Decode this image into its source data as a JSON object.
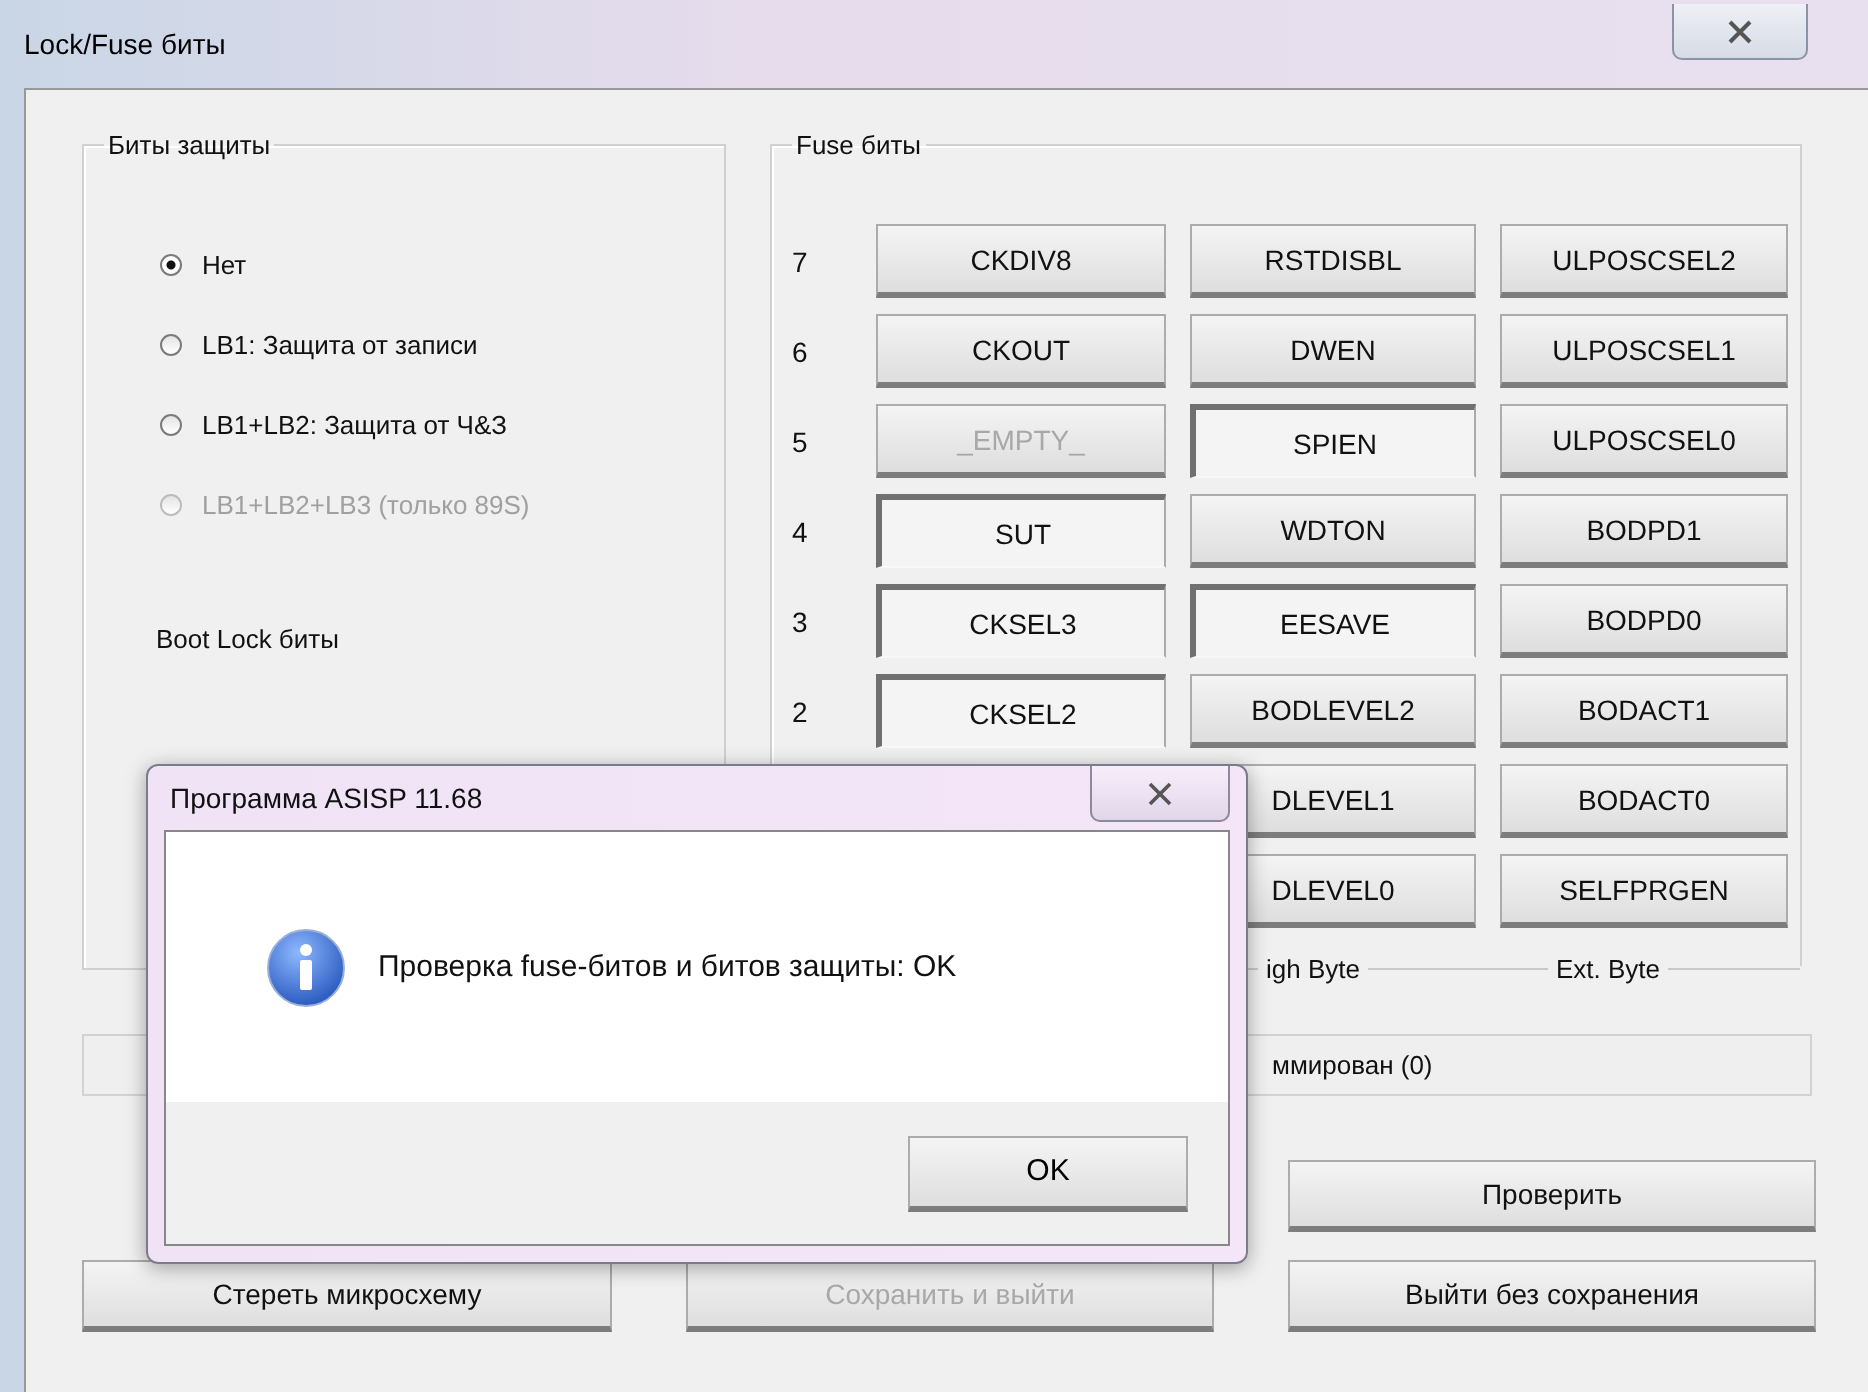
{
  "window": {
    "title": "Lock/Fuse биты"
  },
  "lock_bits": {
    "title": "Биты защиты",
    "options": [
      {
        "label": "Нет",
        "selected": true,
        "disabled": false
      },
      {
        "label": "LB1: Защита от записи",
        "selected": false,
        "disabled": false
      },
      {
        "label": "LB1+LB2: Защита от Ч&З",
        "selected": false,
        "disabled": false
      },
      {
        "label": "LB1+LB2+LB3 (только 89S)",
        "selected": false,
        "disabled": true
      }
    ],
    "boot_lock_label": "Boot Lock биты"
  },
  "fuse_bits": {
    "title": "Fuse биты",
    "rows": [
      {
        "bit": "7",
        "cells": [
          {
            "label": "CKDIV8",
            "pressed": false,
            "disabled": false
          },
          {
            "label": "RSTDISBL",
            "pressed": false,
            "disabled": false
          },
          {
            "label": "ULPOSCSEL2",
            "pressed": false,
            "disabled": false
          }
        ]
      },
      {
        "bit": "6",
        "cells": [
          {
            "label": "CKOUT",
            "pressed": false,
            "disabled": false
          },
          {
            "label": "DWEN",
            "pressed": false,
            "disabled": false
          },
          {
            "label": "ULPOSCSEL1",
            "pressed": false,
            "disabled": false
          }
        ]
      },
      {
        "bit": "5",
        "cells": [
          {
            "label": "_EMPTY_",
            "pressed": false,
            "disabled": true
          },
          {
            "label": "SPIEN",
            "pressed": true,
            "disabled": false
          },
          {
            "label": "ULPOSCSEL0",
            "pressed": false,
            "disabled": false
          }
        ]
      },
      {
        "bit": "4",
        "cells": [
          {
            "label": "SUT",
            "pressed": true,
            "disabled": false
          },
          {
            "label": "WDTON",
            "pressed": false,
            "disabled": false
          },
          {
            "label": "BODPD1",
            "pressed": false,
            "disabled": false
          }
        ]
      },
      {
        "bit": "3",
        "cells": [
          {
            "label": "CKSEL3",
            "pressed": true,
            "disabled": false
          },
          {
            "label": "EESAVE",
            "pressed": true,
            "disabled": false
          },
          {
            "label": "BODPD0",
            "pressed": false,
            "disabled": false
          }
        ]
      },
      {
        "bit": "2",
        "cells": [
          {
            "label": "CKSEL2",
            "pressed": true,
            "disabled": false
          },
          {
            "label": "BODLEVEL2",
            "pressed": false,
            "disabled": false
          },
          {
            "label": "BODACT1",
            "pressed": false,
            "disabled": false
          }
        ]
      },
      {
        "cells": [
          {
            "label": "DLEVEL1",
            "pressed": false,
            "disabled": false
          },
          {
            "label": "BODACT0",
            "pressed": false,
            "disabled": false
          }
        ]
      },
      {
        "cells": [
          {
            "label": "DLEVEL0",
            "pressed": false,
            "disabled": false
          },
          {
            "label": "SELFPRGEN",
            "pressed": false,
            "disabled": false
          }
        ]
      }
    ],
    "byte_labels": [
      "igh Byte",
      "Ext. Byte"
    ]
  },
  "status_field": {
    "text": "ммирован (0)"
  },
  "buttons": [
    [
      {
        "label": "Проверить",
        "disabled": false
      }
    ],
    [
      {
        "label": "Стереть микросхему",
        "disabled": false
      },
      {
        "label": "Сохранить и выйти",
        "disabled": true
      },
      {
        "label": "Выйти без сохранения",
        "disabled": false
      }
    ]
  ],
  "dialog": {
    "title": "Программа ASISP 11.68",
    "message": "Проверка fuse-битов и битов защиты: OK",
    "button": "OK"
  }
}
